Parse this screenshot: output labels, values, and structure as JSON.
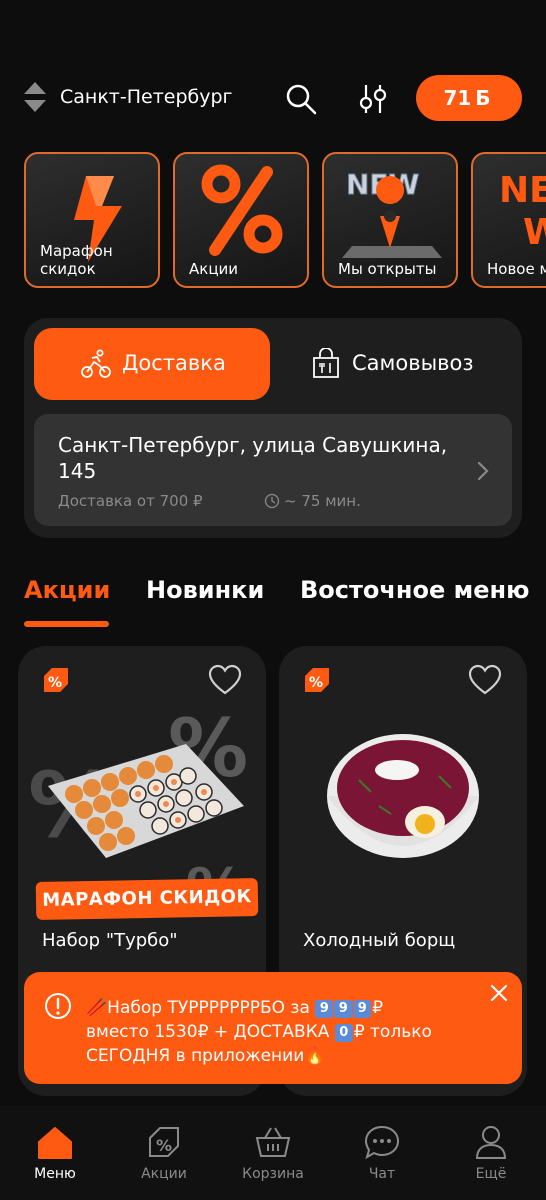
{
  "header": {
    "city": "Санкт-Петербург",
    "bonus_amount": "71",
    "bonus_symbol": "Б"
  },
  "stories": [
    {
      "label": "Марафон скидок",
      "icon": "lightning-icon"
    },
    {
      "label": "Акции",
      "icon": "percent-icon"
    },
    {
      "label": "Мы открыты",
      "icon": "new-pin-icon"
    },
    {
      "label": "Новое меню",
      "icon": "new-text-icon"
    }
  ],
  "delivery": {
    "tabs": [
      {
        "label": "Доставка",
        "icon": "courier-bike-icon",
        "active": true
      },
      {
        "label": "Самовывоз",
        "icon": "takeaway-bag-icon",
        "active": false
      }
    ],
    "address": "Санкт-Петербург, улица Савушкина, 145",
    "min_order": "Доставка от 700 ₽",
    "time": "~ 75 мин."
  },
  "categories": [
    {
      "label": "Акции",
      "active": true
    },
    {
      "label": "Новинки",
      "active": false
    },
    {
      "label": "Восточное меню",
      "active": false
    }
  ],
  "products": [
    {
      "name": "Набор \"Турбо\"",
      "tag": "МАРАФОН СКИДОК",
      "image": "sushi-set-image"
    },
    {
      "name": "Холодный борщ",
      "image": "borscht-bowl-image"
    }
  ],
  "promo": {
    "line1_prefix": "🥢Набор ТУРРРРРРРБО за ",
    "price_digits": [
      "9",
      "9",
      "9"
    ],
    "line1_suffix": "₽",
    "line2_prefix": "вместо 1530₽ + ДОСТАВКА ",
    "zero_digit": "0",
    "line2_suffix": "₽ только",
    "line3": "СЕГОДНЯ в приложении🔥"
  },
  "nav": [
    {
      "label": "Меню",
      "icon": "home-icon",
      "active": true
    },
    {
      "label": "Акции",
      "icon": "discount-tag-icon",
      "active": false
    },
    {
      "label": "Корзина",
      "icon": "basket-icon",
      "active": false
    },
    {
      "label": "Чат",
      "icon": "chat-icon",
      "active": false
    },
    {
      "label": "Ещё",
      "icon": "profile-icon",
      "active": false
    }
  ],
  "colors": {
    "accent": "#ff5a12",
    "background": "#0d0d0d",
    "card": "#1e1e1e"
  }
}
